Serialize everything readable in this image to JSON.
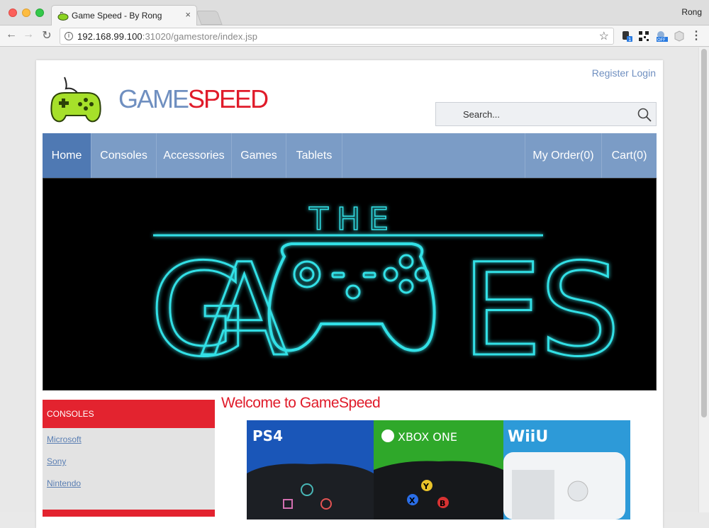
{
  "browser": {
    "tab_title": "Game Speed - By Rong",
    "tab_close": "×",
    "profile_name": "Rong",
    "url_host": "192.168.99.100",
    "url_rest": ":31020/gamestore/index.jsp",
    "back_icon": "←",
    "forward_icon": "→",
    "reload_icon": "↻",
    "star_icon": "☆",
    "menu_icon": "⋮",
    "info_icon": "i"
  },
  "header": {
    "brand_part1": "GAME",
    "brand_part2": "SPEED",
    "register_label": "Register",
    "login_label": "Login",
    "search_placeholder": "Search..."
  },
  "nav": {
    "items": [
      {
        "label": "Home",
        "active": true
      },
      {
        "label": "Consoles"
      },
      {
        "label": "Accessories"
      },
      {
        "label": "Games"
      },
      {
        "label": "Tablets"
      }
    ],
    "right_items": [
      {
        "label": "My Order(0)"
      },
      {
        "label": "Cart(0)"
      }
    ]
  },
  "banner": {
    "top_text": "THE",
    "letters": [
      "G",
      "A",
      "E",
      "S"
    ]
  },
  "sidebar": {
    "heading": "CONSOLES",
    "links": [
      "Microsoft",
      "Sony",
      "Nintendo"
    ]
  },
  "main": {
    "welcome": "Welcome to GameSpeed",
    "panels": [
      {
        "label": "PS4",
        "color": "#1a56b8"
      },
      {
        "label": "XBOX ONE",
        "color": "#2fa82a"
      },
      {
        "label": "WiiU",
        "color": "#2d9ad8"
      }
    ],
    "xbox_buttons": [
      "Y",
      "X",
      "B"
    ]
  },
  "colors": {
    "accent_red": "#e01b2a",
    "nav_blue": "#7b9cc6",
    "nav_active": "#4f79b3",
    "banner_glow": "#33e0e6"
  }
}
